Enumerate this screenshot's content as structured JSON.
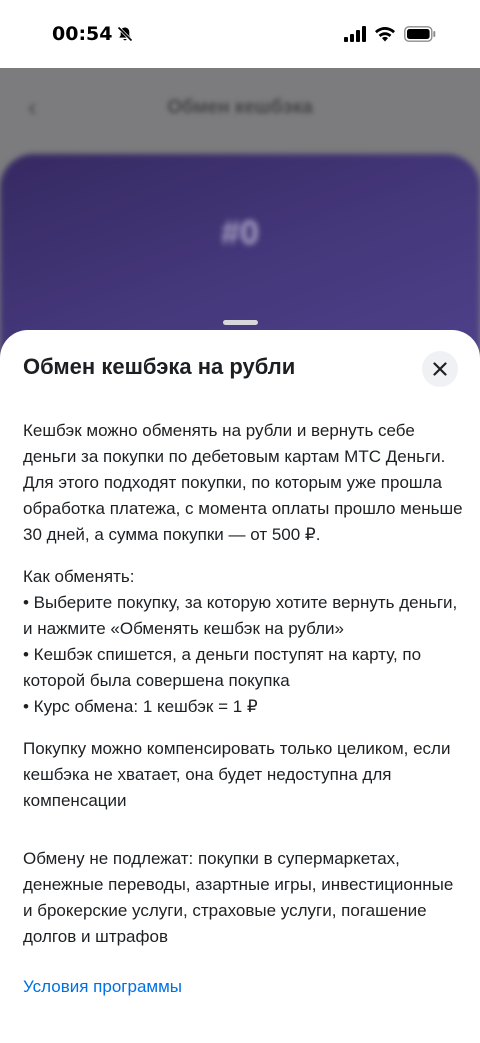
{
  "status_bar": {
    "time": "00:54"
  },
  "background_app": {
    "header_title": "Обмен кешбэка",
    "card_value": "#0"
  },
  "sheet": {
    "title": "Обмен кешбэка на рубли",
    "paragraphs": [
      "Кешбэк можно обменять на рубли и вернуть себе деньги за покупки по дебетовым картам МТС Деньги. Для этого подходят покупки, по которым уже прошла обработка платежа, с момента оплаты прошло меньше 30 дней, а сумма покупки — от 500 ₽."
    ],
    "how_to": {
      "heading": "Как обменять:",
      "items": [
        "• Выберите покупку, за которую хотите вернуть деньги, и нажмите «Обменять кешбэк на рубли»",
        "• Кешбэк спишется, а деньги поступят на карту, по которой была совершена покупка",
        "• Курс обмена: 1 кешбэк = 1 ₽"
      ]
    },
    "compensation_note": "Покупку можно компенсировать только целиком, если кешбэка не хватает, она будет недоступна для компенсации",
    "exclusions": "Обмену не подлежат: покупки в супермаркетах, денежные переводы, азартные игры, инвестиционные и брокерские услуги, страховые услуги, погашение долгов и штрафов",
    "terms_link": "Условия программы"
  },
  "colors": {
    "link": "#0070e5",
    "text": "#1d2023",
    "close_bg": "#eff1f4"
  },
  "icons": [
    "bell-slash-icon",
    "signal-icon",
    "wifi-icon",
    "battery-icon",
    "back-arrow-icon",
    "close-icon"
  ]
}
